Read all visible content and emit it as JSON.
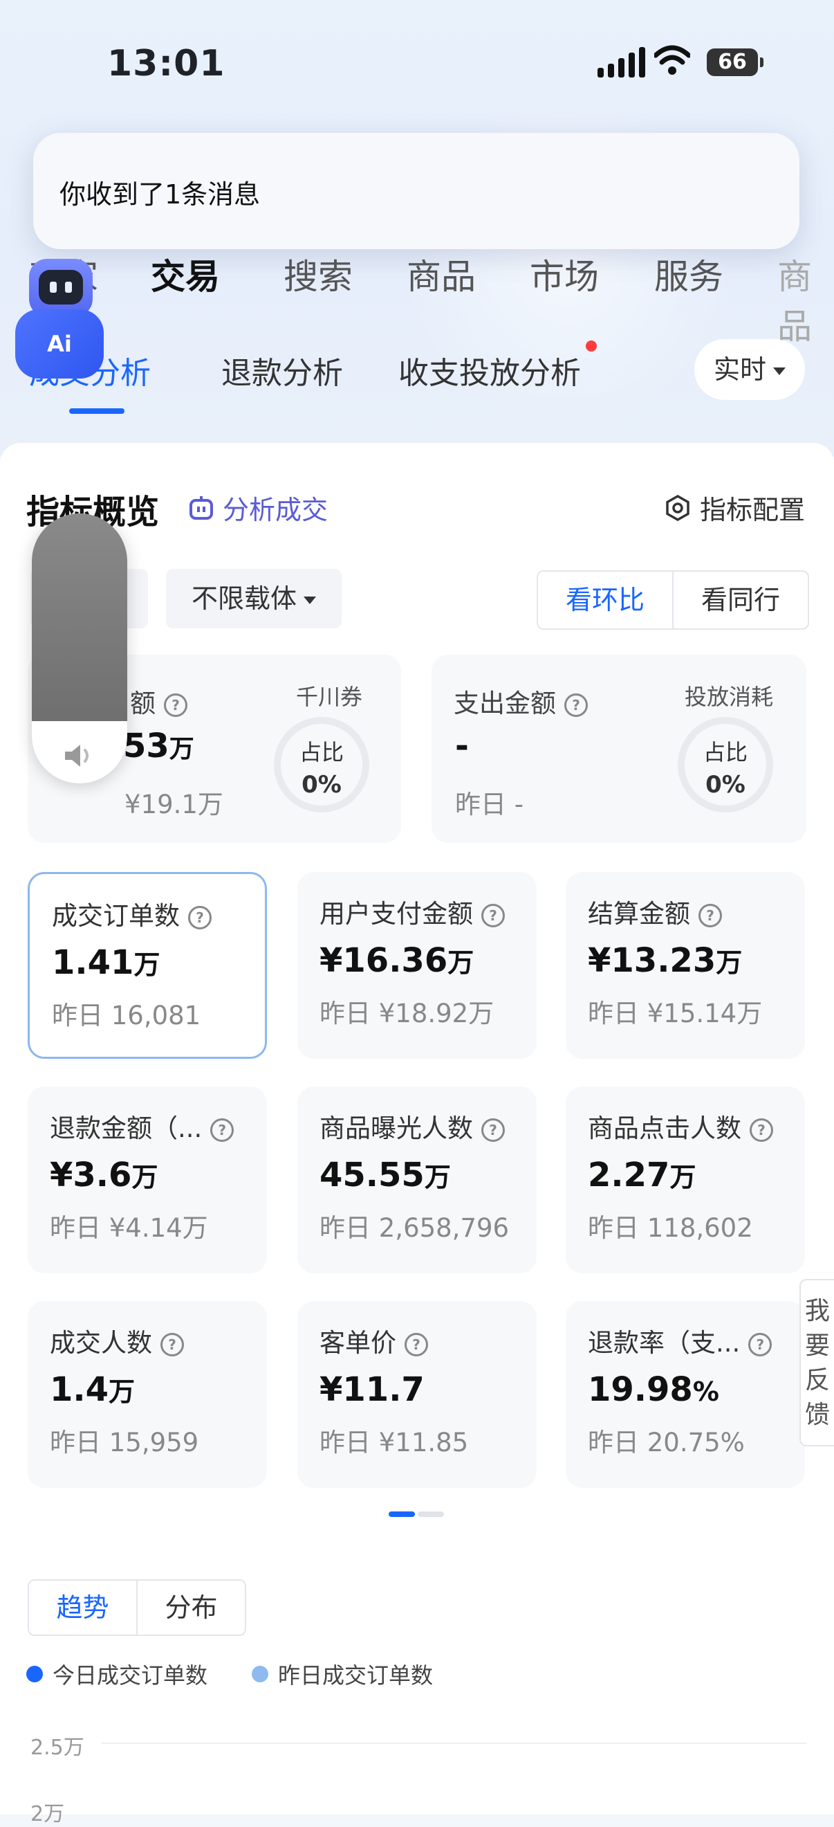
{
  "status_bar": {
    "time": "13:01",
    "battery": "66"
  },
  "notification": {
    "text": "你收到了1条消息"
  },
  "top_nav": {
    "items": [
      "商家",
      "交易",
      "搜索",
      "商品",
      "市场",
      "服务",
      "商品"
    ],
    "active": "交易"
  },
  "sub_tabs": {
    "items": [
      "成交分析",
      "退款分析",
      "收支投放分析"
    ],
    "active": "成交分析",
    "realtime": "实时"
  },
  "bot": {
    "label": "Ai"
  },
  "overview": {
    "title": "指标概览",
    "ai_link": "分析成交",
    "config": "指标配置",
    "filter_carrier": "不限载体",
    "compare_tabs": [
      "看环比",
      "看同行"
    ],
    "cards": [
      {
        "label": "额",
        "value": "53",
        "unit": "万",
        "sub": "¥19.1万",
        "ring_title": "千川券",
        "ring_text": "占比",
        "ring_pct": "0%"
      },
      {
        "label": "支出金额",
        "value": "-",
        "unit": "",
        "sub": "昨日 -",
        "ring_title": "投放消耗",
        "ring_text": "占比",
        "ring_pct": "0%"
      }
    ]
  },
  "metrics": [
    {
      "label": "成交订单数",
      "value": "1.41",
      "unit": "万",
      "sub": "昨日 16,081"
    },
    {
      "label": "用户支付金额",
      "value": "¥16.36",
      "unit": "万",
      "sub": "昨日 ¥18.92万"
    },
    {
      "label": "结算金额",
      "value": "¥13.23",
      "unit": "万",
      "sub": "昨日 ¥15.14万"
    },
    {
      "label": "退款金额（...",
      "value": "¥3.6",
      "unit": "万",
      "sub": "昨日 ¥4.14万"
    },
    {
      "label": "商品曝光人数",
      "value": "45.55",
      "unit": "万",
      "sub": "昨日 2,658,796"
    },
    {
      "label": "商品点击人数",
      "value": "2.27",
      "unit": "万",
      "sub": "昨日 118,602"
    },
    {
      "label": "成交人数",
      "value": "1.4",
      "unit": "万",
      "sub": "昨日 15,959"
    },
    {
      "label": "客单价",
      "value": "¥11.7",
      "unit": "",
      "sub": "昨日 ¥11.85"
    },
    {
      "label": "退款率（支...",
      "value": "19.98",
      "unit": "%",
      "sub": "昨日 20.75%"
    }
  ],
  "feedback": "我要反馈",
  "trend": {
    "tabs": [
      "趋势",
      "分布"
    ],
    "legend": [
      "今日成交订单数",
      "昨日成交订单数"
    ],
    "y_ticks": [
      "2.5万",
      "2万"
    ]
  },
  "colors": {
    "accent": "#1966ff",
    "today": "#1966ff",
    "yesterday": "#8fbaf0"
  }
}
